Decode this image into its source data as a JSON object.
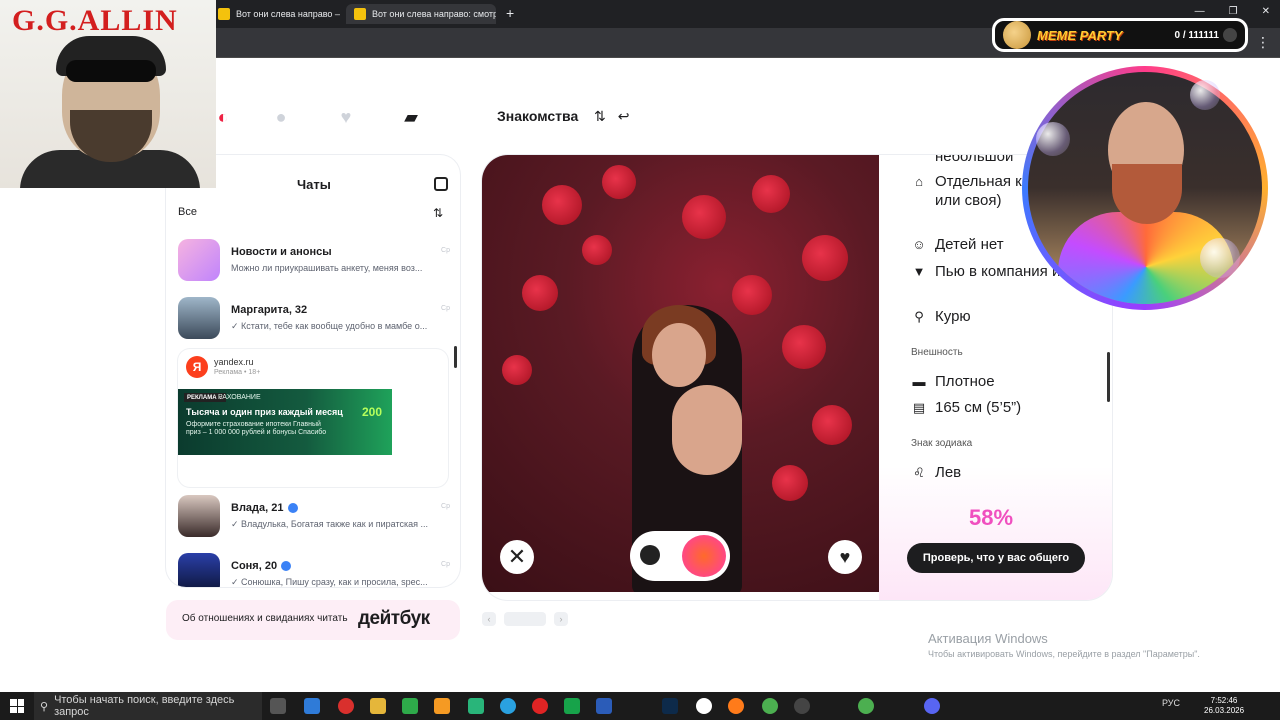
{
  "browser": {
    "tabs": [
      {
        "label": "Вот они слева направо — Янд",
        "close": "✕"
      },
      {
        "label": "Вот они слева направо: смотр",
        "close": "✕"
      }
    ],
    "new_tab": "+",
    "window_controls": [
      "—",
      "❐",
      "✕"
    ],
    "menu": "⋮"
  },
  "overlay": {
    "meme_title": "MEME PARTY",
    "meme_counter": "0 / 111111",
    "webcam_title": "G.G.ALLIN"
  },
  "header": {
    "title": "Знакомства",
    "filter_icon": "⇅",
    "undo_icon": "↩"
  },
  "chats": {
    "title": "Чаты",
    "filter": "Все",
    "items": [
      {
        "name": "Новости и анонсы",
        "message": "Можно ли приукрашивать анкету, меняя воз...",
        "date": "Ср",
        "verified": false
      },
      {
        "name": "Маргарита, 32",
        "message": "✓ Кстати, тебе как вообще удобно в мамбе о...",
        "date": "Ср",
        "verified": false
      },
      {
        "name": "Влада, 21",
        "message": "✓ Владулька, Богатая также как и пиратская ...",
        "date": "Ср",
        "verified": true
      },
      {
        "name": "Соня, 20",
        "message": "✓ Сонюшка, Пишу сразу, как и просила, spec...",
        "date": "Ср",
        "verified": true
      }
    ],
    "ad": {
      "logo": "Я",
      "domain": "yandex.ru",
      "label": "Реклама • 18+",
      "tag": "РЕКЛАМА ⌄",
      "headline_small": "РАХОВАНИЕ",
      "headline": "Тысяча и один приз каждый месяц",
      "body": "Оформите страхование ипотеки\nГлавный приз – 1 000 000 рублей\nи бонусы Спасибо",
      "badge": "200"
    }
  },
  "profile": {
    "rows_top": [
      {
        "icon": "♟",
        "text": "небольшой"
      },
      {
        "icon": "⌂",
        "text": "Отдельная квартира (с или своя)"
      },
      {
        "icon": "☺",
        "text": "Детей нет"
      },
      {
        "icon": "▼",
        "text": "Пью в компания изредка"
      },
      {
        "icon": "⚲",
        "text": "Курю"
      }
    ],
    "section_appearance": "Внешность",
    "appearance": [
      {
        "icon": "▬",
        "text": "Плотное"
      },
      {
        "icon": "▤",
        "text": "165 см (5’5”)"
      }
    ],
    "section_zodiac": "Знак зодиака",
    "zodiac": {
      "icon": "♌",
      "text": "Лев"
    },
    "match_percent": "58%",
    "check_button": "Проверь, что у вас общего",
    "dislike_icon": "✕",
    "like_icon": "♥"
  },
  "footer": {
    "dbook_text": "Об отношениях и свиданиях читать",
    "dbook_brand": "дейтбук"
  },
  "windows": {
    "activate_title": "Активация Windows",
    "activate_text": "Чтобы активировать Windows, перейдите в раздел \"Параметры\"."
  },
  "taskbar": {
    "search_placeholder": "Чтобы начать поиск, введите здесь запрос",
    "lang": "РУС",
    "time": "7:52:46",
    "date": "26.03.2026"
  }
}
